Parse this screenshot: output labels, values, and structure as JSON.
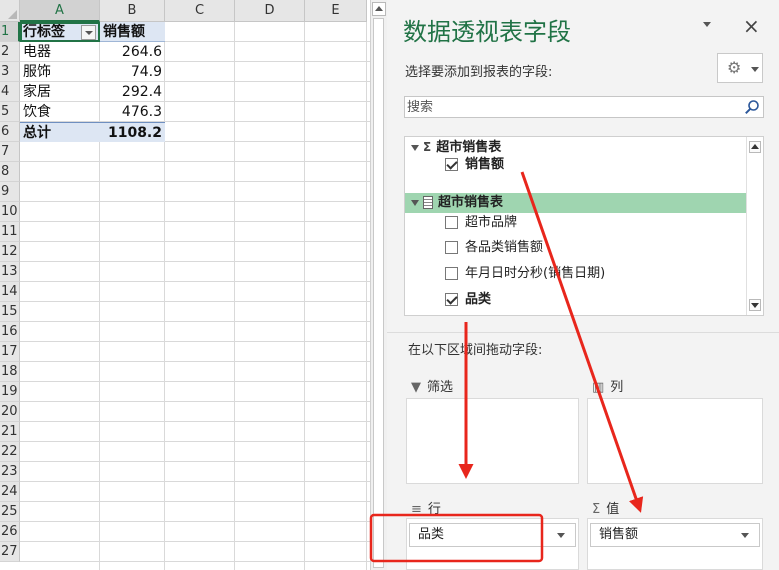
{
  "sheet": {
    "columns": [
      "A",
      "B",
      "C",
      "D",
      "E"
    ],
    "rows": [
      "1",
      "2",
      "3",
      "4",
      "5",
      "6",
      "7",
      "8",
      "9",
      "10",
      "11",
      "12",
      "13",
      "14",
      "15",
      "16",
      "17",
      "18",
      "19",
      "20",
      "21",
      "22",
      "23",
      "24",
      "25",
      "26",
      "27"
    ],
    "header": {
      "label": "行标签",
      "value": "销售额"
    },
    "items": [
      {
        "label": "电器",
        "value": "264.6"
      },
      {
        "label": "服饰",
        "value": "74.9"
      },
      {
        "label": "家居",
        "value": "292.4"
      },
      {
        "label": "饮食",
        "value": "476.3"
      }
    ],
    "total": {
      "label": "总计",
      "value": "1108.2"
    }
  },
  "panel": {
    "title": "数据透视表字段",
    "close": "×",
    "subtitle": "选择要添加到报表的字段:",
    "gear_icon": "gear-icon",
    "search_placeholder": "搜索",
    "groups": [
      {
        "name": "超市销售表",
        "icon": "sigma",
        "fields": [
          {
            "label": "销售额",
            "checked": true
          }
        ]
      },
      {
        "name": "超市销售表",
        "icon": "table",
        "fields": [
          {
            "label": "超市品牌",
            "checked": false
          },
          {
            "label": "各品类销售额",
            "checked": false
          },
          {
            "label": "年月日时分秒(销售日期)",
            "checked": false
          },
          {
            "label": "品类",
            "checked": true
          }
        ]
      }
    ],
    "drag_label": "在以下区域间拖动字段:",
    "areas": {
      "filter": "筛选",
      "columns": "列",
      "rows": "行",
      "values": "值"
    },
    "row_item": "品类",
    "value_item": "销售额"
  },
  "colors": {
    "accent": "#217346",
    "highlight": "#9fd5b0",
    "annotation": "#e8261c"
  }
}
